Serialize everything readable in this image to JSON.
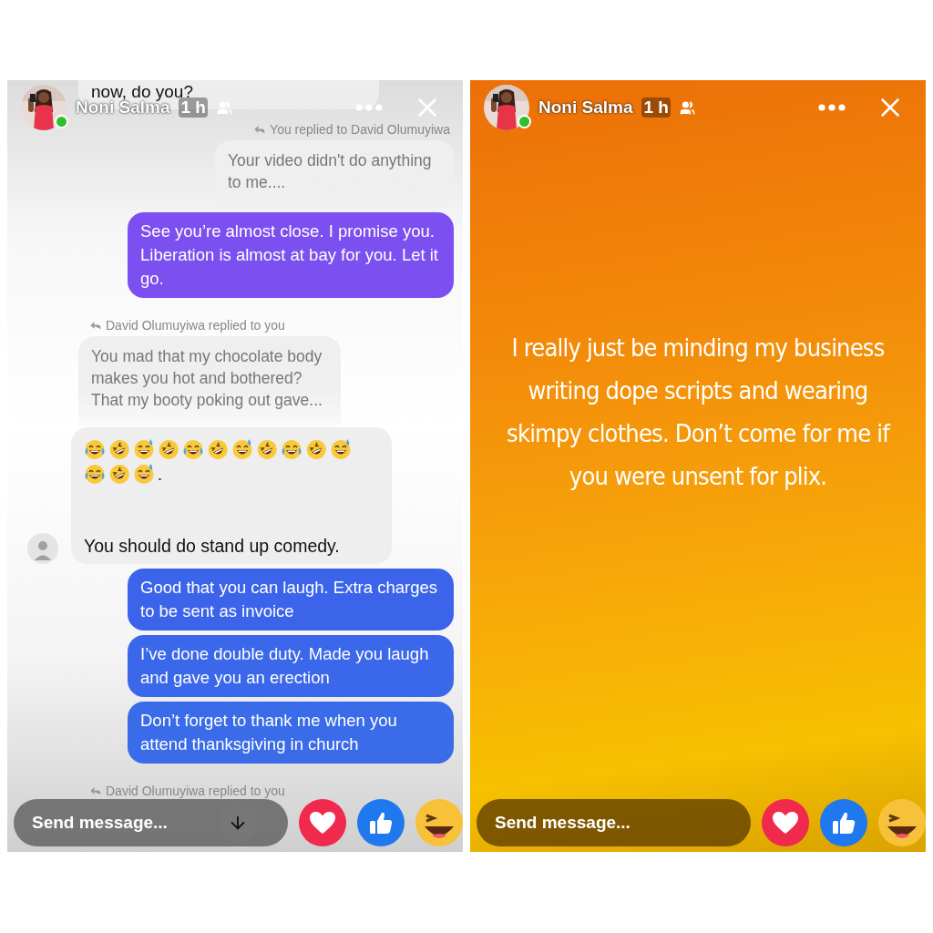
{
  "panels": [
    {
      "kind": "chat",
      "header": {
        "name": "Noni Salma",
        "time": "1 h"
      },
      "messages": [
        {
          "kind": "cut",
          "text": "now, do you?"
        },
        {
          "kind": "label_out",
          "text": "You replied to David Olumuyiwa"
        },
        {
          "kind": "quote_out",
          "text": "Your video didn't do anything to me...."
        },
        {
          "kind": "sent",
          "color": "#7b4ff0",
          "text": "See you’re almost close. I promise you. Liberation is almost at bay for you. Let it go."
        },
        {
          "kind": "label_in",
          "text": "David Olumuyiwa replied to you"
        },
        {
          "kind": "quote_in",
          "text": "You mad that my chocolate body makes you hot and bothered? That my booty poking out gave..."
        },
        {
          "kind": "received",
          "emojis": [
            {
              "kind": "joy"
            },
            {
              "kind": "rofl"
            },
            {
              "kind": "sweat"
            },
            {
              "kind": "rofl"
            },
            {
              "kind": "joy"
            },
            {
              "kind": "rofl"
            },
            {
              "kind": "sweat"
            },
            {
              "kind": "rofl"
            },
            {
              "kind": "joy"
            },
            {
              "kind": "rofl"
            },
            {
              "kind": "sweat"
            },
            {
              "kind": "joy"
            },
            {
              "kind": "rofl"
            },
            {
              "kind": "sweat"
            }
          ],
          "emoji_suffix": ".",
          "text": "You should do stand up comedy."
        },
        {
          "kind": "sent",
          "color": "#3b64ea",
          "text": "Good that you can laugh. Extra charges to be sent as invoice"
        },
        {
          "kind": "sent",
          "color": "#3b67ea",
          "text": "I’ve done double duty. Made you laugh and gave you an erection"
        },
        {
          "kind": "sent",
          "color": "#3a6be8",
          "text": "Don’t forget to thank me when you attend thanksgiving in church"
        },
        {
          "kind": "label_in",
          "text": "David Olumuyiwa replied to you"
        }
      ],
      "composer": {
        "placeholder": "Send message...",
        "scroll_down": true
      }
    },
    {
      "kind": "story",
      "header": {
        "name": "Noni Salma",
        "time": "1 h"
      },
      "story_text": "I really just be minding my business writing dope scripts and wearing skimpy clothes. Don’t come for me if you were unsent for plix.",
      "composer": {
        "placeholder": "Send message..."
      }
    }
  ]
}
